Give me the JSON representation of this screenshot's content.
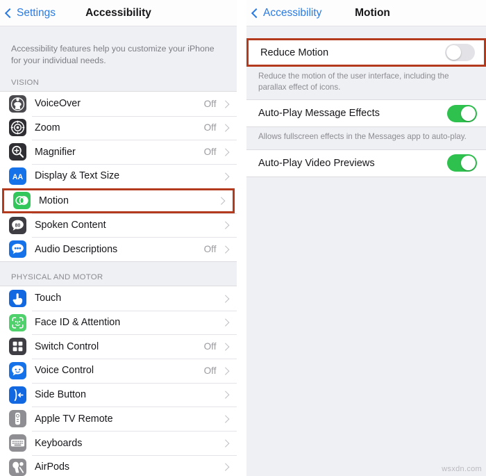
{
  "left_screen": {
    "nav": {
      "back_label": "Settings",
      "title": "Accessibility"
    },
    "intro_text": "Accessibility features help you customize your iPhone for your individual needs.",
    "sections": [
      {
        "header": "VISION",
        "items": [
          {
            "label": "VoiceOver",
            "value": "Off",
            "icon": "voiceover-icon",
            "icon_bg": "#4a4a4f",
            "highlighted": false
          },
          {
            "label": "Zoom",
            "value": "Off",
            "icon": "zoom-icon",
            "icon_bg": "#2e2e33",
            "highlighted": false
          },
          {
            "label": "Magnifier",
            "value": "Off",
            "icon": "magnifier-icon",
            "icon_bg": "#2e2e33",
            "highlighted": false
          },
          {
            "label": "Display & Text Size",
            "value": "",
            "icon": "display-text-size-icon",
            "icon_bg": "#1572e8",
            "highlighted": false
          },
          {
            "label": "Motion",
            "value": "",
            "icon": "motion-icon",
            "icon_bg": "#33c65a",
            "highlighted": true
          },
          {
            "label": "Spoken Content",
            "value": "",
            "icon": "spoken-content-icon",
            "icon_bg": "#3d3d43",
            "highlighted": false
          },
          {
            "label": "Audio Descriptions",
            "value": "Off",
            "icon": "audio-descriptions-icon",
            "icon_bg": "#1572e8",
            "highlighted": false
          }
        ]
      },
      {
        "header": "PHYSICAL AND MOTOR",
        "items": [
          {
            "label": "Touch",
            "value": "",
            "icon": "touch-icon",
            "icon_bg": "#1168e0",
            "highlighted": false
          },
          {
            "label": "Face ID & Attention",
            "value": "",
            "icon": "face-id-icon",
            "icon_bg": "#4fd16b",
            "highlighted": false
          },
          {
            "label": "Switch Control",
            "value": "Off",
            "icon": "switch-control-icon",
            "icon_bg": "#3d3d43",
            "highlighted": false
          },
          {
            "label": "Voice Control",
            "value": "Off",
            "icon": "voice-control-icon",
            "icon_bg": "#1572e8",
            "highlighted": false
          },
          {
            "label": "Side Button",
            "value": "",
            "icon": "side-button-icon",
            "icon_bg": "#1168e0",
            "highlighted": false
          },
          {
            "label": "Apple TV Remote",
            "value": "",
            "icon": "apple-tv-remote-icon",
            "icon_bg": "#8e8e93",
            "highlighted": false
          },
          {
            "label": "Keyboards",
            "value": "",
            "icon": "keyboards-icon",
            "icon_bg": "#8e8e93",
            "highlighted": false
          },
          {
            "label": "AirPods",
            "value": "",
            "icon": "airpods-icon",
            "icon_bg": "#8e8e93",
            "highlighted": false
          }
        ]
      }
    ]
  },
  "right_screen": {
    "nav": {
      "back_label": "Accessibility",
      "title": "Motion"
    },
    "rows": [
      {
        "label": "Reduce Motion",
        "toggle": "off",
        "footnote": "Reduce the motion of the user interface, including the parallax effect of icons.",
        "highlighted": true
      },
      {
        "label": "Auto-Play Message Effects",
        "toggle": "on",
        "footnote": "Allows fullscreen effects in the Messages app to auto-play.",
        "highlighted": false
      },
      {
        "label": "Auto-Play Video Previews",
        "toggle": "on",
        "footnote": "",
        "highlighted": false
      }
    ]
  },
  "watermark": "wsxdn.com",
  "colors": {
    "highlight_border": "#b33a1c",
    "toggle_on": "#2fc14e",
    "toggle_off": "#e3e3e7",
    "link_blue": "#2a7ae2"
  }
}
